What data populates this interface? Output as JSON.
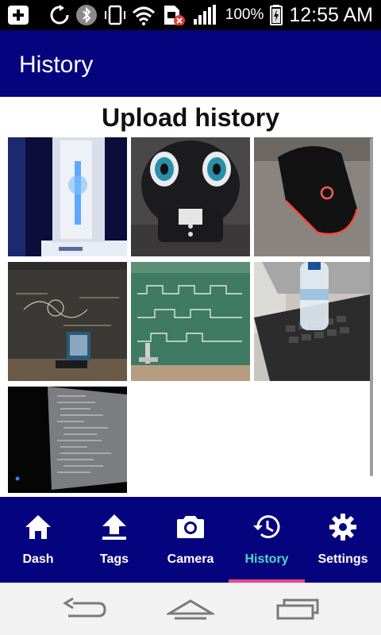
{
  "status_bar": {
    "battery_percent": "100%",
    "time": "12:55 AM",
    "icons": [
      "plus-box-icon",
      "sync-icon",
      "bluetooth-icon",
      "vibrate-icon",
      "wifi-icon",
      "sim-error-icon",
      "signal-icon",
      "battery-charging-icon"
    ]
  },
  "app_bar": {
    "title": "History"
  },
  "main": {
    "section_title": "Upload history",
    "photos": [
      {
        "subject": "router-photo"
      },
      {
        "subject": "plush-toy-photo"
      },
      {
        "subject": "gaming-mouse-photo"
      },
      {
        "subject": "chalkboard-photo"
      },
      {
        "subject": "green-board-waveform-photo"
      },
      {
        "subject": "laptop-water-bottle-photo"
      },
      {
        "subject": "code-screen-photo"
      }
    ]
  },
  "bottom_nav": {
    "items": [
      {
        "label": "Dash",
        "icon": "home-icon"
      },
      {
        "label": "Tags",
        "icon": "upload-icon"
      },
      {
        "label": "Camera",
        "icon": "camera-icon"
      },
      {
        "label": "History",
        "icon": "history-icon",
        "active": true
      },
      {
        "label": "Settings",
        "icon": "gear-icon"
      }
    ]
  },
  "system_nav": {
    "buttons": [
      "back-icon",
      "home-icon",
      "recents-icon"
    ]
  },
  "colors": {
    "app_bar": "#06037f",
    "active_tab_label": "#4fd6c4",
    "active_indicator": "#e64a86",
    "status_bar": "#000000"
  }
}
